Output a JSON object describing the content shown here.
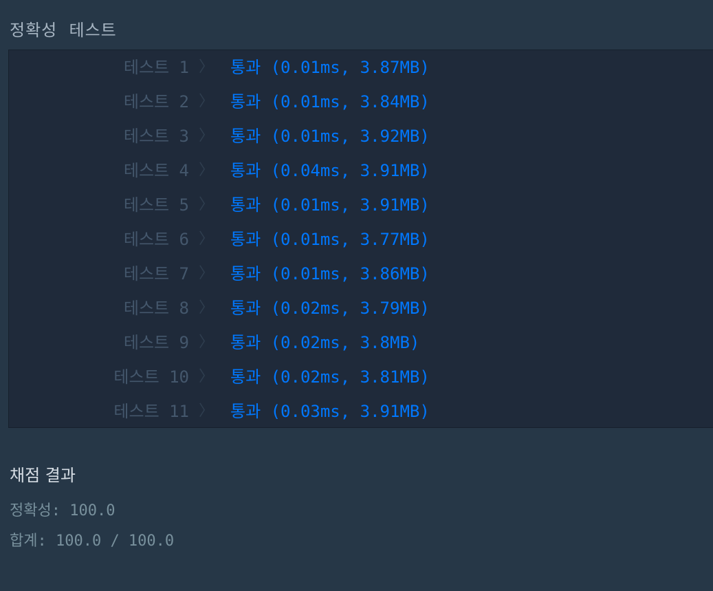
{
  "accuracy_section": {
    "title": "정확성  테스트"
  },
  "tests": [
    {
      "label": "테스트 1",
      "result": "통과 (0.01ms, 3.87MB)"
    },
    {
      "label": "테스트 2",
      "result": "통과 (0.01ms, 3.84MB)"
    },
    {
      "label": "테스트 3",
      "result": "통과 (0.01ms, 3.92MB)"
    },
    {
      "label": "테스트 4",
      "result": "통과 (0.04ms, 3.91MB)"
    },
    {
      "label": "테스트 5",
      "result": "통과 (0.01ms, 3.91MB)"
    },
    {
      "label": "테스트 6",
      "result": "통과 (0.01ms, 3.77MB)"
    },
    {
      "label": "테스트 7",
      "result": "통과 (0.01ms, 3.86MB)"
    },
    {
      "label": "테스트 8",
      "result": "통과 (0.02ms, 3.79MB)"
    },
    {
      "label": "테스트 9",
      "result": "통과 (0.02ms, 3.8MB)"
    },
    {
      "label": "테스트 10",
      "result": "통과 (0.02ms, 3.81MB)"
    },
    {
      "label": "테스트 11",
      "result": "통과 (0.03ms, 3.91MB)"
    }
  ],
  "grading": {
    "title": "채점 결과",
    "accuracy": "정확성: 100.0",
    "total": "합계: 100.0 / 100.0"
  },
  "colors": {
    "background": "#263747",
    "panel": "#1f2a3a",
    "pass": "#0078ff",
    "label": "#44576c"
  },
  "icons": {
    "row_separator": "chevron-right-icon"
  }
}
